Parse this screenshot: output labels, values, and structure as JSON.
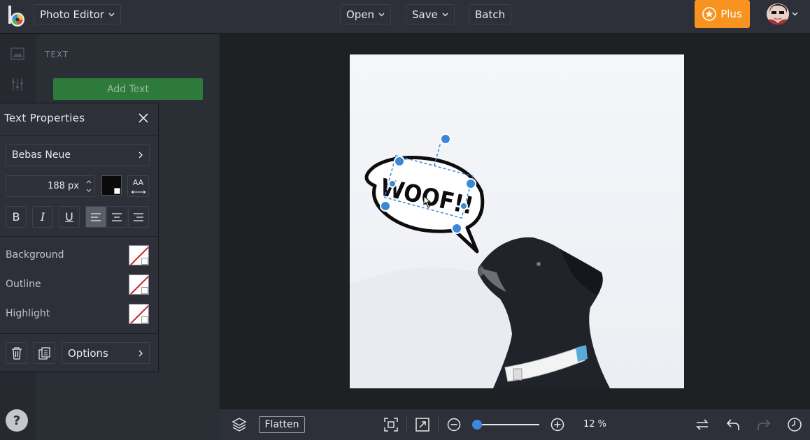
{
  "topbar": {
    "app_menu_label": "Photo Editor",
    "open_label": "Open",
    "save_label": "Save",
    "batch_label": "Batch",
    "plus_label": "Plus"
  },
  "side_panel": {
    "title": "TEXT",
    "add_text_label": "Add Text"
  },
  "text_properties": {
    "title": "Text Properties",
    "font_name": "Bebas Neue",
    "size_value": "188 px",
    "spacing_label": "AA",
    "bold_label": "B",
    "italic_label": "I",
    "underline_label": "U",
    "background_label": "Background",
    "outline_label": "Outline",
    "highlight_label": "Highlight",
    "options_label": "Options",
    "text_color": "#0a0a0a"
  },
  "canvas": {
    "bubble_text": "WOOF!!"
  },
  "bottombar": {
    "flatten_label": "Flatten",
    "zoom_value": "12 %",
    "zoom_fraction": 0.0
  },
  "help_label": "?",
  "colors": {
    "accent_orange": "#f7931e",
    "accent_green": "#2d7a3a",
    "selection_blue": "#3b87d9"
  }
}
